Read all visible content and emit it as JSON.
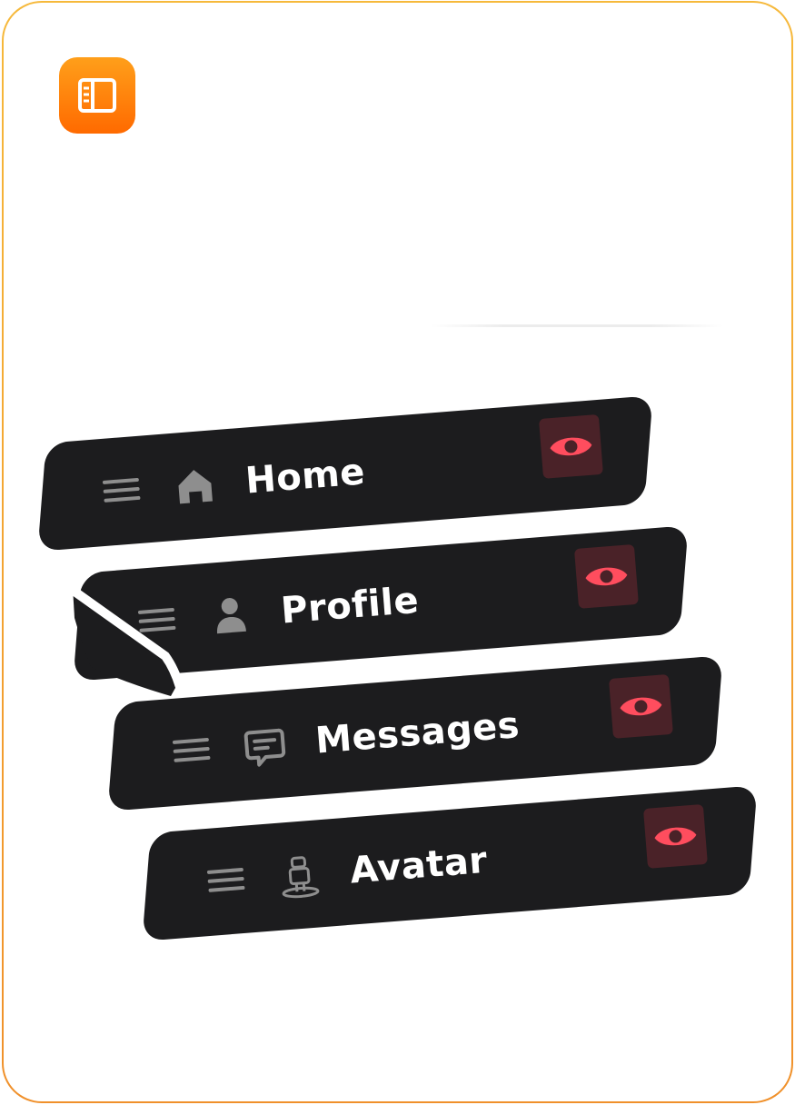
{
  "app": {
    "icon": "sidebar-icon",
    "accent_color": "#ff8a00"
  },
  "nav": {
    "items": [
      {
        "label": "Home",
        "icon": "home-icon",
        "visible": true
      },
      {
        "label": "Profile",
        "icon": "user-icon",
        "visible": true,
        "dragging": true
      },
      {
        "label": "Messages",
        "icon": "message-icon",
        "visible": true
      },
      {
        "label": "Avatar",
        "icon": "avatar-icon",
        "visible": true
      }
    ],
    "visibility_icon": "eye-icon",
    "visibility_color": "#ff4d5e",
    "row_color": "#1c1c1e"
  }
}
